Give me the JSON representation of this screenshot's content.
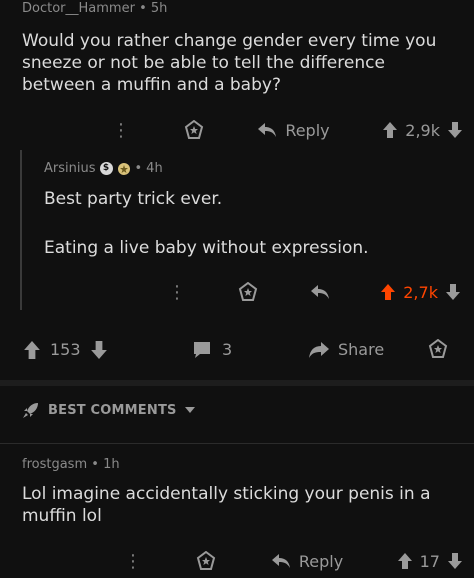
{
  "top_comment": {
    "author": "Doctor__Hammer",
    "time": "5h",
    "text": "Would you rather change gender every time you sneeze or not be able to tell the difference between a muffin and a baby?",
    "reply_label": "Reply",
    "score": "2,9k"
  },
  "reply_comment": {
    "author": "Arsinius",
    "badge": "$",
    "time": "4h",
    "line1": "Best party trick ever.",
    "line2": "Eating a live baby without expression.",
    "score": "2,7k",
    "score_color": "#ff4500"
  },
  "post_bar": {
    "upvotes": "153",
    "comments": "3",
    "share_label": "Share"
  },
  "best_comments": {
    "label": "BEST COMMENTS"
  },
  "bottom_comment": {
    "author": "frostgasm",
    "time": "1h",
    "text": "Lol imagine accidentally sticking your penis in a muffin lol",
    "reply_label": "Reply",
    "score": "17"
  },
  "separator": "•",
  "kebab_glyph": "⋮"
}
